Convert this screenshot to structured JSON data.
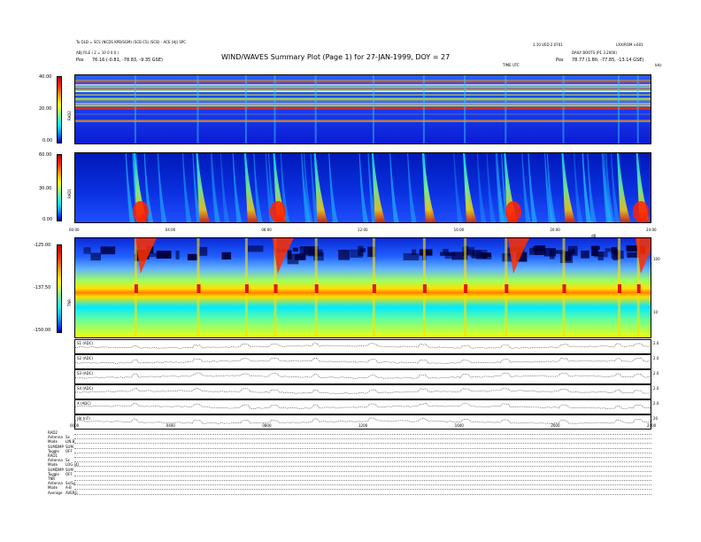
{
  "header": {
    "title": "WIND/WAVES Summary Plot (Page 1) for 27-JAN-1999, DOY = 27",
    "left_line1": "To OLD = SCS (NCDS KPB/SGM) (SCB CS) (SCB) - ACE (HJ) SPC",
    "left_line2": "ABJ FILE ( 2 = 10 0 0 0 )",
    "left_pos_label": "Pos",
    "left_pos_value": "76.16 (-0.81, -78.83, -9.35 GSE)",
    "right_line1": "1.10 VED 2.0701",
    "right_line1b": "LXX/ROM v.601",
    "right_line2": "DAILY BOOTS (P1 3.2000)",
    "right_pos_label": "Pos",
    "right_pos_value": "78.77 (1.80, -77.85, -13.14 GSE)",
    "time_axis_label": "TIME UTC",
    "corner_label": "kHz"
  },
  "panels": {
    "rad2": {
      "label": "RAD2",
      "ticks": [
        "40.00",
        "20.00",
        "0.00"
      ]
    },
    "rad1": {
      "label": "RAD1",
      "ticks": [
        "60.00",
        "30.00",
        "0.00"
      ]
    },
    "tnr": {
      "label": "TNR",
      "ticks": [
        "-125.00",
        "-137.50",
        "-150.00"
      ],
      "right_ticks": [
        "100",
        "10"
      ],
      "right_unit": "dB"
    },
    "time_ticks_mid": [
      "00:00",
      "04:00",
      "08:00",
      "12:00",
      "16:00",
      "20:00",
      "24:00"
    ],
    "time_ticks_bottom": [
      "0000",
      "0400",
      "0800",
      "1200",
      "1600",
      "2000",
      "2400"
    ]
  },
  "line_plots": [
    {
      "label": "S1 (ADC)",
      "right": "2.0"
    },
    {
      "label": "S2 (ADC)",
      "right": "2.0"
    },
    {
      "label": "S3 (ADC)",
      "right": "2.0"
    },
    {
      "label": "S4 (ADC)",
      "right": "2.0"
    },
    {
      "label": "X (ADC)",
      "right": "2.0"
    },
    {
      "label": "|B| (nT)",
      "right": "20"
    }
  ],
  "footer": [
    {
      "name": "RAD2",
      "value": ""
    },
    {
      "name": "Antenna",
      "value": "Sx"
    },
    {
      "name": "Mode",
      "value": "LIN B"
    },
    {
      "name": "SUMDMP",
      "value": "SUM"
    },
    {
      "name": "Toggle",
      "value": "OFF"
    },
    {
      "name": "RAD1",
      "value": ""
    },
    {
      "name": "Antenna",
      "value": "Sx"
    },
    {
      "name": "Mode",
      "value": "LOG (4)"
    },
    {
      "name": "SUMDMP",
      "value": "SUM"
    },
    {
      "name": "Toggle",
      "value": "OFF"
    },
    {
      "name": "TNR",
      "value": ""
    },
    {
      "name": "Antenna",
      "value": "Sx/Sy"
    },
    {
      "name": "Mode",
      "value": "A-B"
    },
    {
      "name": "Average",
      "value": "AVERG"
    }
  ],
  "colors": {
    "deep": "#00008c",
    "blue": "#0040ff",
    "cyan": "#00e8ff",
    "green": "#80ff80",
    "yellow": "#ffff00",
    "orange": "#ff9000",
    "red": "#e00000"
  },
  "chart_data": {
    "type": "heatmap",
    "xlim": [
      "00:00",
      "24:00"
    ],
    "panels": [
      "RAD2",
      "RAD1",
      "TNR"
    ],
    "burst_times_hours": [
      2.5,
      5.1,
      7.1,
      8.3,
      10.0,
      12.4,
      14.5,
      16.2,
      17.9,
      20.3,
      22.6,
      23.4
    ],
    "strong_burst_hours": [
      2.5,
      8.2,
      18.0,
      23.3
    ]
  }
}
